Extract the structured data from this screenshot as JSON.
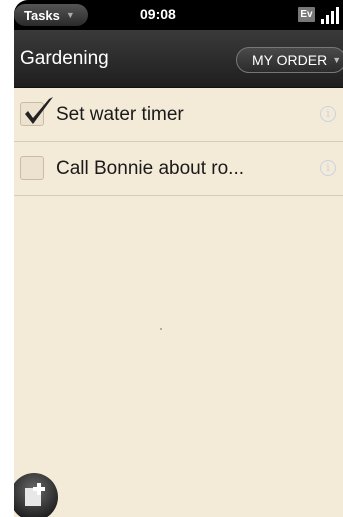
{
  "status_bar": {
    "app_menu_label": "Tasks",
    "time": "09:08",
    "carrier_label": "Ev"
  },
  "header": {
    "title": "Gardening",
    "order_button_label": "MY ORDER"
  },
  "tasks": [
    {
      "label": "Set water timer",
      "checked": true
    },
    {
      "label": "Call Bonnie about ro...",
      "checked": false
    }
  ],
  "icons": {
    "info": "info-icon",
    "add_task": "new-task-icon"
  }
}
